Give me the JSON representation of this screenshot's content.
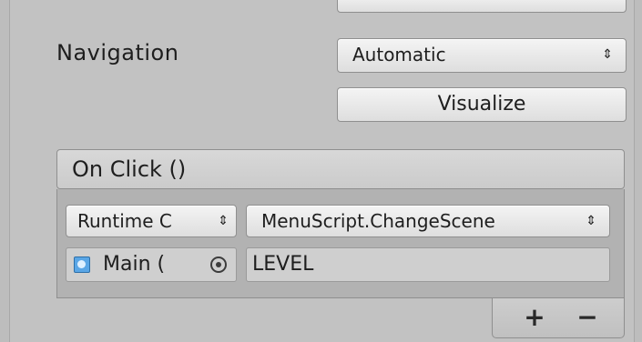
{
  "navigation": {
    "label": "Navigation",
    "selected": "Automatic",
    "visualize_label": "Visualize"
  },
  "on_click": {
    "header": "On Click ()",
    "entries": [
      {
        "call_state": "Runtime C",
        "function": "MenuScript.ChangeScene",
        "target_object": "Main (",
        "argument": "LEVEL"
      }
    ],
    "add_label": "+",
    "remove_label": "−"
  },
  "icons": {
    "updown": "⇕",
    "object": "gameobject-icon",
    "picker": "object-picker-icon"
  }
}
